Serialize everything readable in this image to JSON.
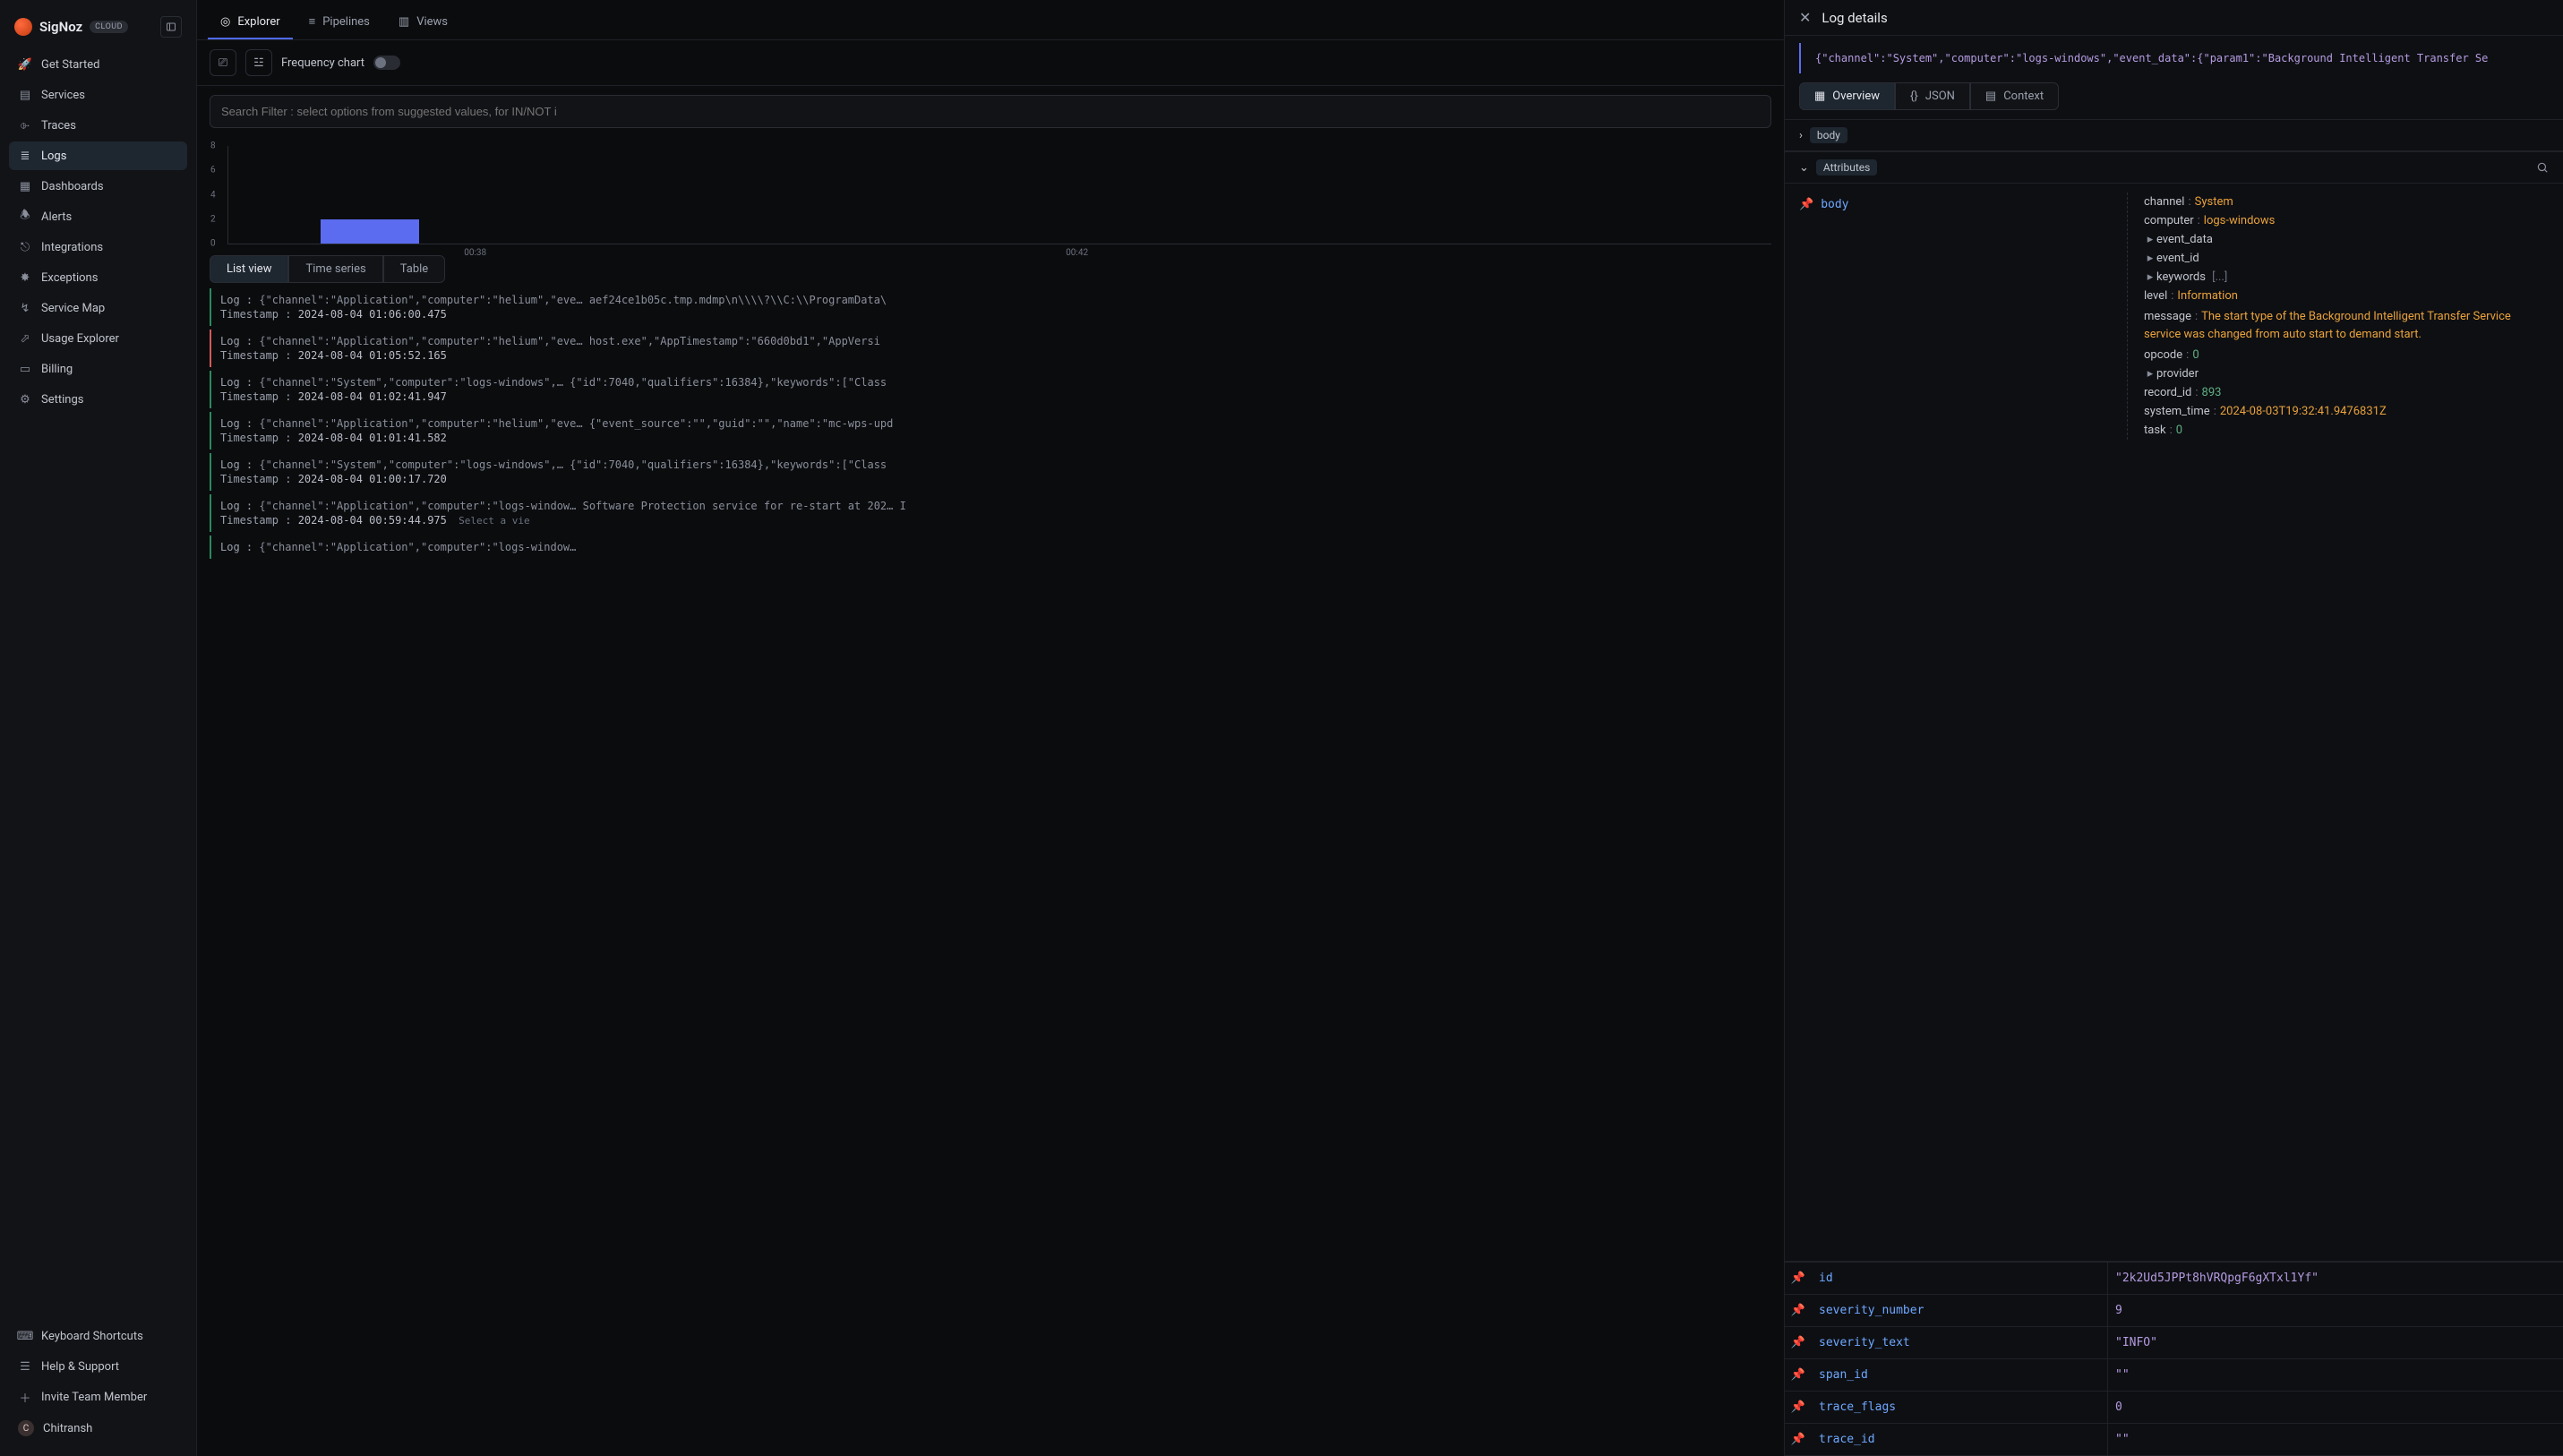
{
  "brand": {
    "name": "SigNoz",
    "badge": "CLOUD"
  },
  "sidebar": {
    "items": [
      {
        "label": "Get Started"
      },
      {
        "label": "Services"
      },
      {
        "label": "Traces"
      },
      {
        "label": "Logs"
      },
      {
        "label": "Dashboards"
      },
      {
        "label": "Alerts"
      },
      {
        "label": "Integrations"
      },
      {
        "label": "Exceptions"
      },
      {
        "label": "Service Map"
      },
      {
        "label": "Usage Explorer"
      },
      {
        "label": "Billing"
      },
      {
        "label": "Settings"
      }
    ],
    "bottom": [
      {
        "label": "Keyboard Shortcuts"
      },
      {
        "label": "Help & Support"
      },
      {
        "label": "Invite Team Member"
      }
    ],
    "user": {
      "initial": "C",
      "name": "Chitransh"
    }
  },
  "topTabs": [
    {
      "label": "Explorer",
      "active": true
    },
    {
      "label": "Pipelines",
      "active": false
    },
    {
      "label": "Views",
      "active": false
    }
  ],
  "toolbar": {
    "freqLabel": "Frequency chart"
  },
  "search": {
    "placeholder": "Search Filter : select options from suggested values, for IN/NOT i"
  },
  "chart_data": {
    "type": "bar",
    "ylim": [
      0,
      8
    ],
    "yticks": [
      0,
      2,
      4,
      6,
      8
    ],
    "xticks": [
      "00:38",
      "00:42"
    ],
    "bars": [
      {
        "x_pct": 6,
        "height": 2
      }
    ]
  },
  "viewTabs": [
    {
      "label": "List view",
      "active": true
    },
    {
      "label": "Time series",
      "active": false
    },
    {
      "label": "Table",
      "active": false
    }
  ],
  "logs": [
    {
      "sev": "ok",
      "body": "{\"channel\":\"Application\",\"computer\":\"helium\",\"eve… aef24ce1b05c.tmp.mdmp\\n\\\\\\\\?\\\\C:\\\\ProgramData\\",
      "ts": "2024-08-04 01:06:00.475",
      "truncatedHead": true
    },
    {
      "sev": "err",
      "body": "{\"channel\":\"Application\",\"computer\":\"helium\",\"eve… host.exe\",\"AppTimestamp\":\"660d0bd1\",\"AppVersi",
      "ts": "2024-08-04 01:05:52.165"
    },
    {
      "sev": "ok",
      "body": "{\"channel\":\"System\",\"computer\":\"logs-windows\",… {\"id\":7040,\"qualifiers\":16384},\"keywords\":[\"Class",
      "ts": "2024-08-04 01:02:41.947"
    },
    {
      "sev": "ok",
      "body": "{\"channel\":\"Application\",\"computer\":\"helium\",\"eve… {\"event_source\":\"\",\"guid\":\"\",\"name\":\"mc-wps-upd",
      "ts": "2024-08-04 01:01:41.582"
    },
    {
      "sev": "ok",
      "body": "{\"channel\":\"System\",\"computer\":\"logs-windows\",… {\"id\":7040,\"qualifiers\":16384},\"keywords\":[\"Class",
      "ts": "2024-08-04 01:00:17.720"
    },
    {
      "sev": "ok",
      "body": "{\"channel\":\"Application\",\"computer\":\"logs-window… Software Protection service for re-start at 202… I",
      "ts": "2024-08-04 00:59:44.975",
      "hint": "Select a vie"
    },
    {
      "sev": "ok",
      "body": "{\"channel\":\"Application\",\"computer\":\"logs-window…",
      "ts": ""
    }
  ],
  "panel": {
    "title": "Log details",
    "raw_preview": "{\"channel\":\"System\",\"computer\":\"logs-windows\",\"event_data\":{\"param1\":\"Background Intelligent Transfer Se",
    "segTabs": [
      {
        "label": "Overview",
        "active": true
      },
      {
        "label": "JSON",
        "active": false
      },
      {
        "label": "Context",
        "active": false
      }
    ],
    "section_body": "body",
    "section_attr": "Attributes",
    "body_label": "body",
    "attributes": {
      "channel": "System",
      "computer": "logs-windows",
      "event_data_label": "event_data",
      "event_id_label": "event_id",
      "keywords_label": "keywords",
      "keywords_suffix": "[...]",
      "level": "Information",
      "message_key": "message",
      "message_val": "The start type of the Background Intelligent Transfer Service service was changed from auto start to demand start.",
      "opcode": 0,
      "provider_label": "provider",
      "record_id": 893,
      "system_time": "2024-08-03T19:32:41.9476831Z",
      "task": 0
    },
    "kv": [
      {
        "k": "id",
        "v": "\"2k2Ud5JPPt8hVRQpgF6gXTxl1Yf\""
      },
      {
        "k": "severity_number",
        "v": "9"
      },
      {
        "k": "severity_text",
        "v": "\"INFO\""
      },
      {
        "k": "span_id",
        "v": "\"\""
      },
      {
        "k": "trace_flags",
        "v": "0"
      },
      {
        "k": "trace_id",
        "v": "\"\""
      }
    ]
  }
}
